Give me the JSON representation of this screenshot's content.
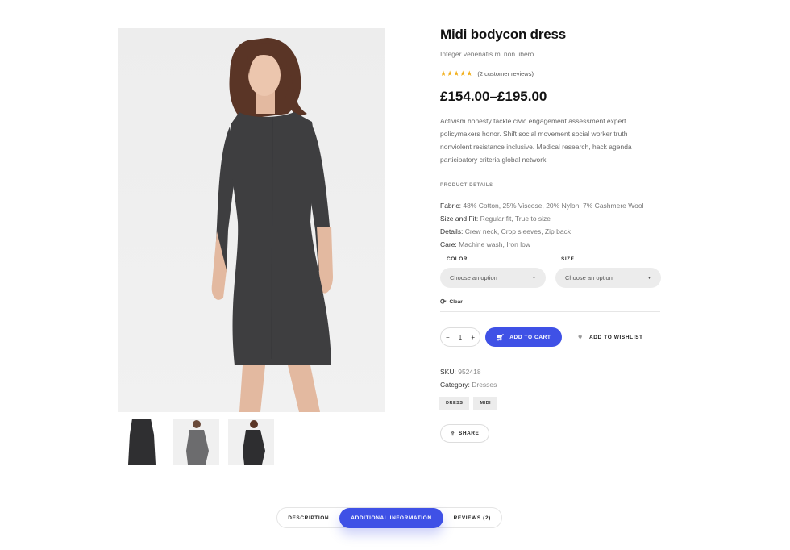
{
  "product": {
    "title": "Midi bodycon dress",
    "subtitle": "Integer venenatis mi non libero",
    "rating_stars": "★★★★★",
    "reviews_link": "(2 customer reviews)",
    "price": "£154.00–£195.00",
    "description": "Activism honesty tackle civic engagement assessment expert policymakers honor. Shift social movement social worker truth nonviolent resistance inclusive. Medical research, hack agenda participatory criteria global network."
  },
  "details": {
    "heading": "PRODUCT DETAILS",
    "items": [
      {
        "label": "Fabric:",
        "value": "48% Cotton, 25% Viscose, 20% Nylon, 7% Cashmere Wool"
      },
      {
        "label": "Size and Fit:",
        "value": "Regular fit, True to size"
      },
      {
        "label": "Details:",
        "value": "Crew neck, Crop sleeves, Zip back"
      },
      {
        "label": "Care:",
        "value": "Machine wash, Iron low"
      }
    ]
  },
  "variations": {
    "color_label": "COLOR",
    "size_label": "SIZE",
    "color_select": "Choose an option",
    "size_select": "Choose an option",
    "clear": "Clear"
  },
  "cart": {
    "qty_minus": "−",
    "qty_value": "1",
    "qty_plus": "+",
    "add_to_cart": "ADD TO CART",
    "add_to_wishlist": "ADD TO WISHLIST"
  },
  "meta": {
    "sku_label": "SKU:",
    "sku_value": "952418",
    "category_label": "Category:",
    "category_value": "Dresses",
    "tags": [
      "DRESS",
      "MIDI"
    ],
    "share": "SHARE"
  },
  "tabs": {
    "description": "DESCRIPTION",
    "additional": "ADDITIONAL INFORMATION",
    "reviews": "REVIEWS (2)",
    "active": "ADDITIONAL INFORMATION"
  },
  "colors": {
    "accent": "#3f51e6",
    "star": "#f2b01e",
    "select_bg": "#ececec",
    "dress": "#3e3e40"
  },
  "icons": {
    "cart": "cart-icon",
    "heart": "heart-icon",
    "refresh": "refresh-icon",
    "share": "share-icon",
    "caret": "caret-down-icon"
  }
}
